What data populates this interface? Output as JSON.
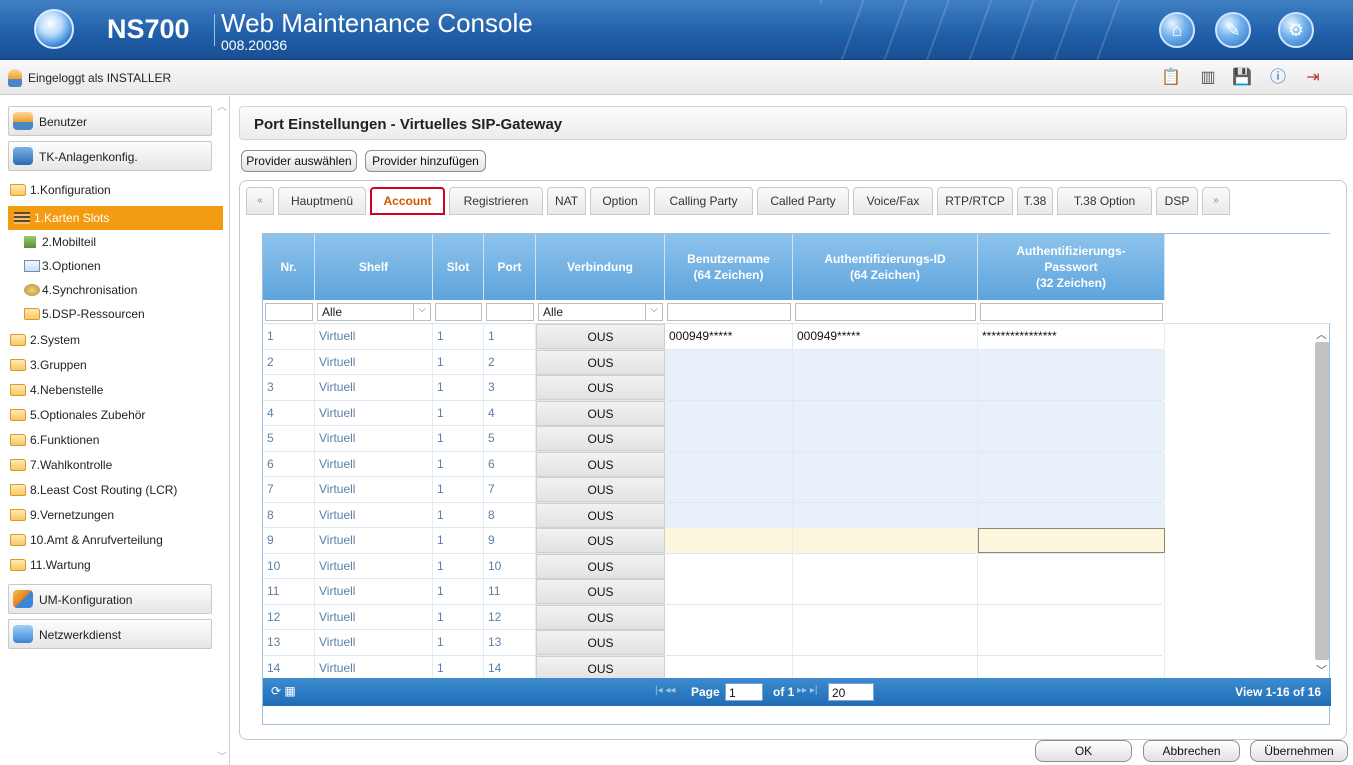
{
  "header": {
    "model": "NS700",
    "title": "Web Maintenance Console",
    "version": "008.20036",
    "buttons": [
      "home-icon",
      "wrench-icon",
      "gear-icon"
    ]
  },
  "loginbar": {
    "text": "Eingeloggt als INSTALLER",
    "icons": [
      "clipboard-icon",
      "server-icon",
      "save-icon",
      "info-icon",
      "exit-icon"
    ]
  },
  "sidebar": {
    "groups": [
      {
        "label": "Benutzer",
        "icon": "user-icon"
      },
      {
        "label": "TK-Anlagenkonfig.",
        "icon": "pbx-icon"
      },
      {
        "label": "UM-Konfiguration",
        "icon": "mail-icon"
      },
      {
        "label": "Netzwerkdienst",
        "icon": "network-icon"
      }
    ],
    "items": [
      {
        "label": "1.Konfiguration"
      },
      {
        "label": "1.Karten Slots"
      },
      {
        "label": "2.Mobilteil"
      },
      {
        "label": "3.Optionen"
      },
      {
        "label": "4.Synchronisation"
      },
      {
        "label": "5.DSP-Ressourcen"
      },
      {
        "label": "2.System"
      },
      {
        "label": "3.Gruppen"
      },
      {
        "label": "4.Nebenstelle"
      },
      {
        "label": "5.Optionales Zubehör"
      },
      {
        "label": "6.Funktionen"
      },
      {
        "label": "7.Wahlkontrolle"
      },
      {
        "label": "8.Least Cost Routing (LCR)"
      },
      {
        "label": "9.Vernetzungen"
      },
      {
        "label": "10.Amt & Anrufverteilung"
      },
      {
        "label": "11.Wartung"
      }
    ]
  },
  "main": {
    "title": "Port Einstellungen - Virtuelles SIP-Gateway",
    "buttons": {
      "select_provider": "Provider auswählen",
      "add_provider": "Provider hinzufügen"
    },
    "tabs": [
      {
        "label": "«"
      },
      {
        "label": "Hauptmenü"
      },
      {
        "label": "Account"
      },
      {
        "label": "Registrieren"
      },
      {
        "label": "NAT"
      },
      {
        "label": "Option"
      },
      {
        "label": "Calling Party"
      },
      {
        "label": "Called Party"
      },
      {
        "label": "Voice/Fax"
      },
      {
        "label": "RTP/RTCP"
      },
      {
        "label": "T.38"
      },
      {
        "label": "T.38 Option"
      },
      {
        "label": "DSP"
      },
      {
        "label": "»"
      }
    ],
    "active_tab": "Account",
    "accent_color": "#d0021b"
  },
  "table": {
    "columns": [
      "Nr.",
      "Shelf",
      "Slot",
      "Port",
      "Verbindung",
      "Benutzername\n(64 Zeichen)",
      "Authentifizierungs-ID\n(64 Zeichen)",
      "Authentifizierungs-\nPasswort\n(32 Zeichen)"
    ],
    "filters": {
      "shelf": "Alle",
      "verbindung": "Alle"
    },
    "rows": [
      {
        "nr": "1",
        "shelf": "Virtuell",
        "slot": "1",
        "port": "1",
        "conn": "OUS",
        "user": "000949*****",
        "auth": "000949*****",
        "pass": "****************"
      },
      {
        "nr": "2",
        "shelf": "Virtuell",
        "slot": "1",
        "port": "2",
        "conn": "OUS",
        "user": "",
        "auth": "",
        "pass": ""
      },
      {
        "nr": "3",
        "shelf": "Virtuell",
        "slot": "1",
        "port": "3",
        "conn": "OUS",
        "user": "",
        "auth": "",
        "pass": ""
      },
      {
        "nr": "4",
        "shelf": "Virtuell",
        "slot": "1",
        "port": "4",
        "conn": "OUS",
        "user": "",
        "auth": "",
        "pass": ""
      },
      {
        "nr": "5",
        "shelf": "Virtuell",
        "slot": "1",
        "port": "5",
        "conn": "OUS",
        "user": "",
        "auth": "",
        "pass": ""
      },
      {
        "nr": "6",
        "shelf": "Virtuell",
        "slot": "1",
        "port": "6",
        "conn": "OUS",
        "user": "",
        "auth": "",
        "pass": ""
      },
      {
        "nr": "7",
        "shelf": "Virtuell",
        "slot": "1",
        "port": "7",
        "conn": "OUS",
        "user": "",
        "auth": "",
        "pass": ""
      },
      {
        "nr": "8",
        "shelf": "Virtuell",
        "slot": "1",
        "port": "8",
        "conn": "OUS",
        "user": "",
        "auth": "",
        "pass": ""
      },
      {
        "nr": "9",
        "shelf": "Virtuell",
        "slot": "1",
        "port": "9",
        "conn": "OUS",
        "user": "",
        "auth": "",
        "pass": ""
      },
      {
        "nr": "10",
        "shelf": "Virtuell",
        "slot": "1",
        "port": "10",
        "conn": "OUS",
        "user": "",
        "auth": "",
        "pass": ""
      },
      {
        "nr": "11",
        "shelf": "Virtuell",
        "slot": "1",
        "port": "11",
        "conn": "OUS",
        "user": "",
        "auth": "",
        "pass": ""
      },
      {
        "nr": "12",
        "shelf": "Virtuell",
        "slot": "1",
        "port": "12",
        "conn": "OUS",
        "user": "",
        "auth": "",
        "pass": ""
      },
      {
        "nr": "13",
        "shelf": "Virtuell",
        "slot": "1",
        "port": "13",
        "conn": "OUS",
        "user": "",
        "auth": "",
        "pass": ""
      },
      {
        "nr": "14",
        "shelf": "Virtuell",
        "slot": "1",
        "port": "14",
        "conn": "OUS",
        "user": "",
        "auth": "",
        "pass": ""
      }
    ],
    "pager": {
      "page_label": "Page",
      "page_value": "1",
      "of_label": "of 1",
      "per_page": "20",
      "view": "View 1-16 of 16"
    }
  },
  "footer": {
    "ok": "OK",
    "cancel": "Abbrechen",
    "apply": "Übernehmen"
  }
}
